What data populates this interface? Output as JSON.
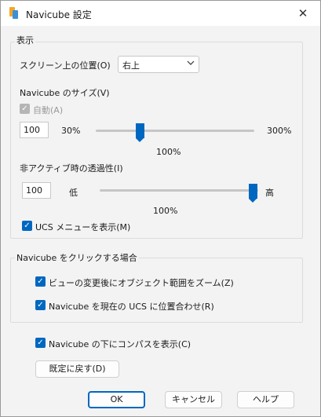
{
  "window": {
    "title": "Navicube 設定"
  },
  "display_group": {
    "title": "表示",
    "position_label": "スクリーン上の位置(O)",
    "position_value": "右上",
    "size_label": "Navicube のサイズ(V)",
    "auto_label": "自動(A)",
    "size_value": "100",
    "size_min_label": "30%",
    "size_max_label": "300%",
    "size_percent_text": "100%",
    "size_slider_fraction": 0.26,
    "opacity_label": "非アクティブ時の透過性(I)",
    "opacity_value": "100",
    "opacity_low_label": "低",
    "opacity_high_label": "高",
    "opacity_percent_text": "100%",
    "opacity_slider_fraction": 1.0,
    "ucs_menu_label": "UCS メニューを表示(M)"
  },
  "click_group": {
    "title": "Navicube をクリックする場合",
    "zoom_label": "ビューの変更後にオブジェクト範囲をズーム(Z)",
    "align_label": "Navicube を現在の UCS に位置合わせ(R)"
  },
  "compass_label": "Navicube の下にコンパスを表示(C)",
  "restore_button": "既定に戻す(D)",
  "ok_button": "OK",
  "cancel_button": "キャンセル",
  "help_button": "ヘルプ",
  "colors": {
    "accent": "#0067c0"
  }
}
